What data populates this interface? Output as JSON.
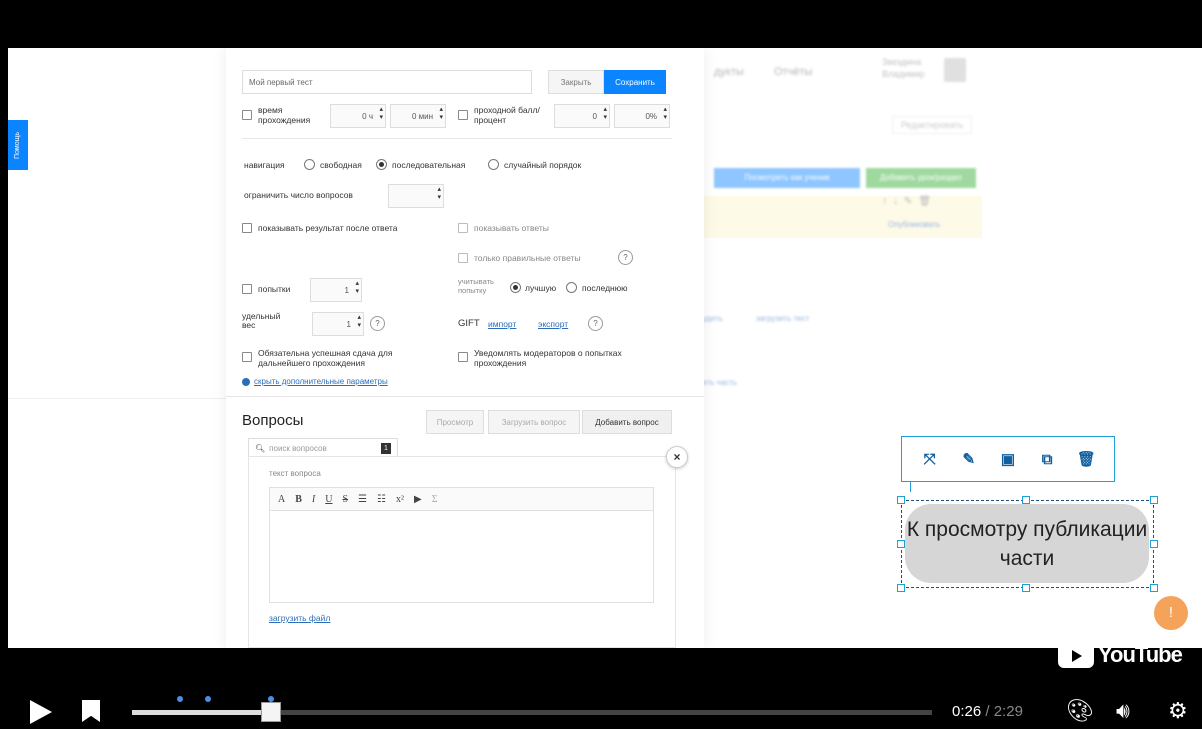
{
  "help_tab": "Помощь",
  "background": {
    "nav_items": [
      "дукты",
      "Отчёты"
    ],
    "user_name": [
      "Звездина",
      "Владимир"
    ],
    "edit_label": "Редактировать",
    "btn_preview_all": "Посмотреть как ученик",
    "btn_add_section": "Добавить урок/раздел",
    "publish_link": "Опубликовать",
    "link_upload_test": "загрузить тест",
    "link_section": "ить часть",
    "link_prefix": "удить"
  },
  "modal": {
    "title_value": "Мой первый тест",
    "btn_close": "Закрыть",
    "btn_save": "Сохранить",
    "time_label": "время прохождения",
    "hours": "0 ч",
    "minutes": "0 мин",
    "passing_label": "проходной балл/процент",
    "passing_score": "0",
    "passing_percent": "0%",
    "navigation_label": "навигация",
    "nav_free": "свободная",
    "nav_sequential": "последовательная",
    "nav_random": "случайный порядок",
    "limit_questions": "ограничить число вопросов",
    "show_result": "показывать результат после ответа",
    "show_answers": "показывать ответы",
    "only_correct": "только правильные ответы",
    "attempts_label": "попытки",
    "attempts_value": "1",
    "count_attempt_label": "учитывать попытку",
    "count_best": "лучшую",
    "count_last": "последнюю",
    "weight_label": "удельный вес",
    "weight_value": "1",
    "gift_label": "GIFT",
    "gift_import": "импорт",
    "gift_export": "экспорт",
    "mandatory_pass": "Обязательна успешная сдача для дальнейшего прохождения",
    "notify_moderators": "Уведомлять модераторов о попытках прохождения",
    "hide_params": "скрыть дополнительные параметры",
    "help_glyph": "?",
    "questions_title": "Вопросы",
    "btn_preview": "Просмотр",
    "btn_upload_questions": "Загрузить вопрос",
    "btn_add_question": "Добавить вопрос",
    "search_placeholder": "поиск вопросов",
    "search_count": "1",
    "question_text_label": "текст вопроса",
    "toolbar_items": [
      "A",
      "B",
      "I",
      "U",
      "S",
      "☰",
      "☷",
      "x²",
      "▶",
      "Σ"
    ],
    "upload_file": "загрузить файл",
    "close_glyph": "×"
  },
  "annotation": {
    "text": "К просмотру публикации части",
    "tools": [
      "expand-icon",
      "pencil-icon",
      "layer-front-icon",
      "copy-icon",
      "trash-icon"
    ],
    "tool_glyphs": [
      "⤧",
      "✎",
      "▣",
      "⧉",
      "🗑"
    ]
  },
  "overlay": {
    "feedback_glyph": "!",
    "youtube_wordmark": "YouTube"
  },
  "player": {
    "current_time": "0:26",
    "separator": " / ",
    "duration": "2:29",
    "progress_fraction": 0.174,
    "chapter_marks": [
      0.06,
      0.095,
      0.174
    ],
    "accent_color": "#4a90e2"
  }
}
